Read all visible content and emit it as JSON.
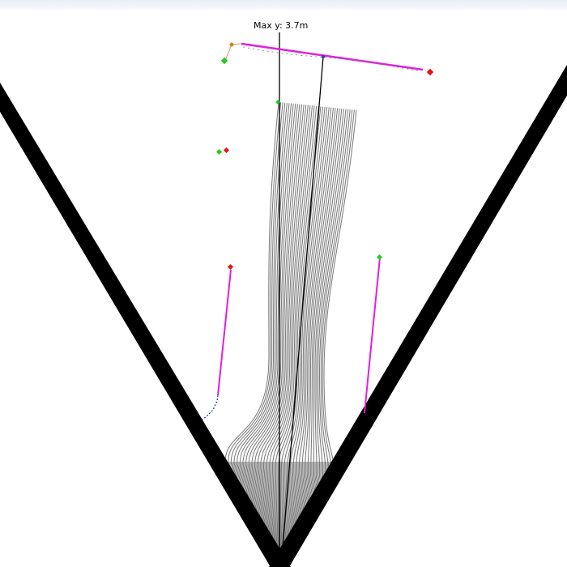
{
  "header": {
    "max_y_label": "Max y: 3.7m"
  },
  "colors": {
    "background": "#ffffff",
    "walls": "#000000",
    "strands": "#777777",
    "whip": "#e020e0",
    "start_marker": "#22cc22",
    "end_marker": "#ee1111"
  }
}
